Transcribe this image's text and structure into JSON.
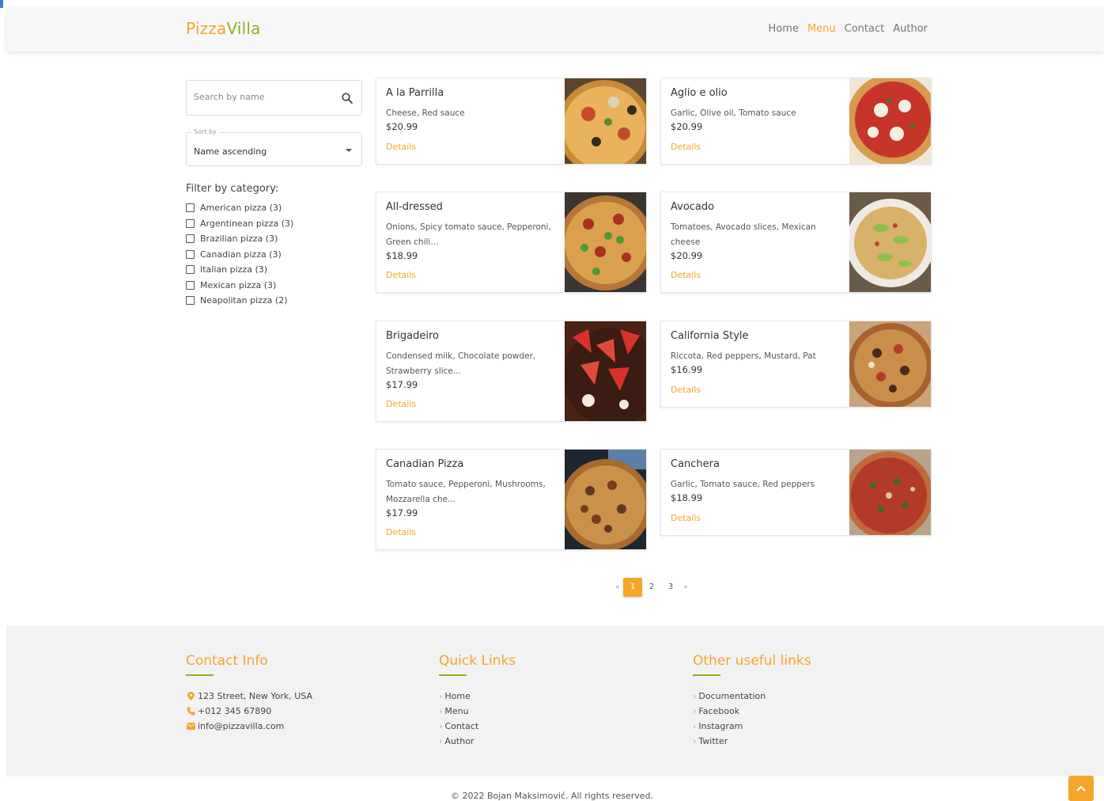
{
  "header": {
    "logo_part1": "Pizza",
    "logo_part2": "Villa",
    "nav": [
      "Home",
      "Menu",
      "Contact",
      "Author"
    ],
    "active_nav": "Menu"
  },
  "sidebar": {
    "search_placeholder": "Search by name",
    "sort_label": "Sort by",
    "sort_value": "Name ascending",
    "filter_title": "Filter by category:",
    "filters": [
      "American pizza (3)",
      "Argentinean pizza (3)",
      "Brazilian pizza (3)",
      "Canadian pizza (3)",
      "Italian pizza (3)",
      "Mexican pizza (3)",
      "Neapolitan pizza (2)"
    ]
  },
  "products": [
    {
      "name": "A la Parrilla",
      "ingredients": "Cheese, Red sauce",
      "price": "$20.99",
      "details": "Details"
    },
    {
      "name": "Aglio e olio",
      "ingredients": "Garlic, Olive oil, Tomato sauce",
      "price": "$20.99",
      "details": "Details"
    },
    {
      "name": "All-dressed",
      "ingredients": "Onions, Spicy tomato sauce, Pepperoni, Green chili...",
      "price": "$18.99",
      "details": "Details"
    },
    {
      "name": "Avocado",
      "ingredients": "Tomatoes, Avocado slices, Mexican cheese",
      "price": "$20.99",
      "details": "Details"
    },
    {
      "name": "Brigadeiro",
      "ingredients": "Condensed milk, Chocolate powder, Strawberry slice...",
      "price": "$17.99",
      "details": "Details"
    },
    {
      "name": "California Style",
      "ingredients": "Riccota, Red peppers, Mustard, Pat",
      "price": "$16.99",
      "details": "Details"
    },
    {
      "name": "Canadian Pizza",
      "ingredients": "Tomato sauce, Pepperoni, Mushrooms, Mozzarella che...",
      "price": "$17.99",
      "details": "Details"
    },
    {
      "name": "Canchera",
      "ingredients": "Garlic, Tomato sauce, Red peppers",
      "price": "$18.99",
      "details": "Details"
    }
  ],
  "pagination": {
    "prev": "«",
    "pages": [
      "1",
      "2",
      "3"
    ],
    "current": "1",
    "next": "»"
  },
  "footer": {
    "contact_title": "Contact Info",
    "contact": {
      "address": "123 Street, New York, USA",
      "phone": "+012 345 67890",
      "email": "info@pizzavilla.com"
    },
    "quick_title": "Quick Links",
    "quick_links": [
      "Home",
      "Menu",
      "Contact",
      "Author"
    ],
    "other_title": "Other useful links",
    "other_links": [
      "Documentation",
      "Facebook",
      "Instagram",
      "Twitter"
    ]
  },
  "copyright": "© 2022 Bojan Maksimović. All rights reserved.",
  "colors": {
    "accent": "#f4a62a",
    "green": "#8bb21c"
  }
}
